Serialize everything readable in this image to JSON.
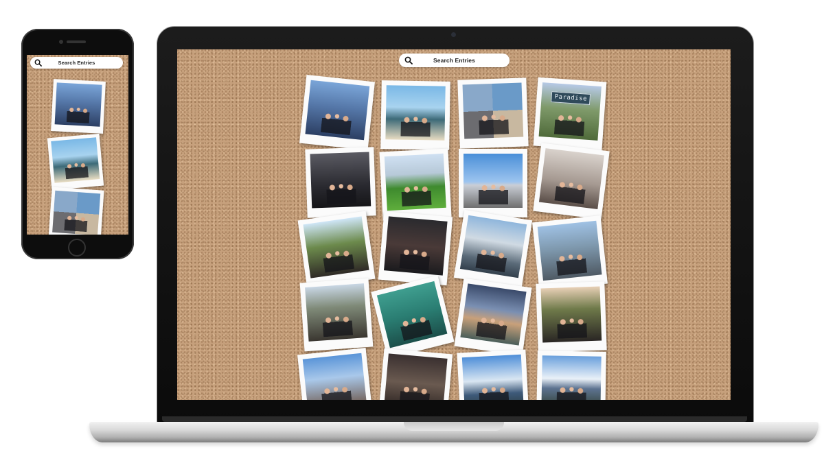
{
  "laptop": {
    "search": {
      "label": "Search Entries",
      "icon": "search-icon"
    },
    "polaroids": [
      {
        "theme": "lake"
      },
      {
        "theme": "beach"
      },
      {
        "theme": "split"
      },
      {
        "theme": "field",
        "sign": "Paradise"
      },
      {
        "theme": "indoor"
      },
      {
        "theme": "grass"
      },
      {
        "theme": "road"
      },
      {
        "theme": "room"
      },
      {
        "theme": "trees"
      },
      {
        "theme": "night"
      },
      {
        "theme": "harbor"
      },
      {
        "theme": "rocks"
      },
      {
        "theme": "autumn"
      },
      {
        "theme": "teal"
      },
      {
        "theme": "sunset"
      },
      {
        "theme": "couple"
      },
      {
        "theme": "selfie"
      },
      {
        "theme": "museum"
      },
      {
        "theme": "mount"
      },
      {
        "theme": "snow"
      }
    ]
  },
  "phone": {
    "search": {
      "label": "Search Entries",
      "icon": "search-icon"
    },
    "polaroids": [
      {
        "theme": "lake"
      },
      {
        "theme": "beach"
      },
      {
        "theme": "split"
      }
    ]
  },
  "colors": {
    "cork": "#c6a07c",
    "polaroid_frame": "#fbfbfb",
    "search_bar": "#ffffff"
  }
}
